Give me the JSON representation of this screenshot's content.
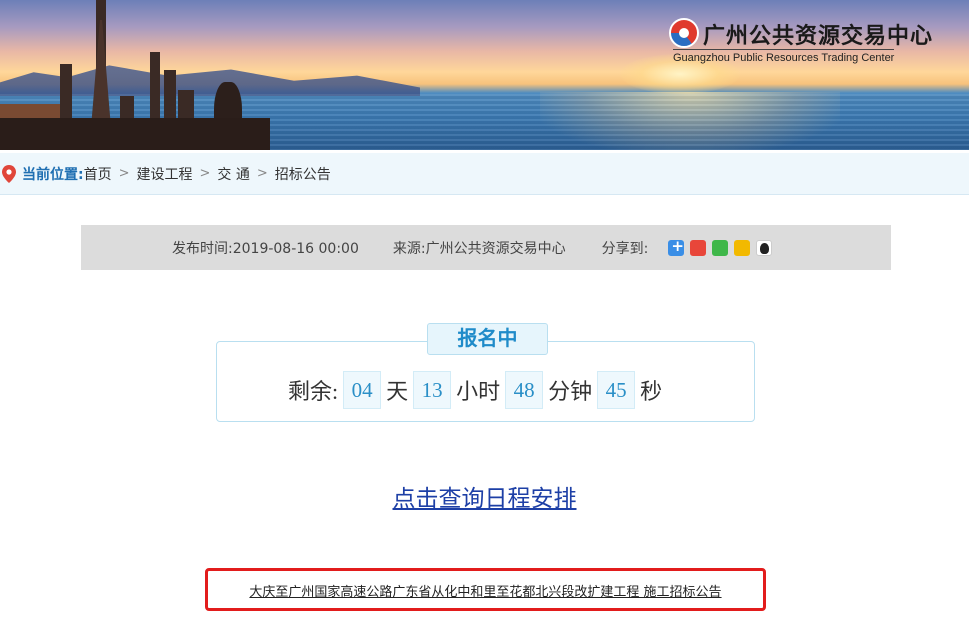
{
  "banner": {
    "logo_cn": "广州公共资源交易中心",
    "logo_en": "Guangzhou Public Resources Trading Center",
    "logo_icon": "gpr-logo-icon"
  },
  "breadcrumb": {
    "title": "当前位置:",
    "items": [
      "首页",
      "建设工程",
      "交 通",
      "招标公告"
    ],
    "separator": ">",
    "icon": "location-pin-icon"
  },
  "info": {
    "publish_time": "发布时间:2019-08-16 00:00",
    "source": "来源:广州公共资源交易中心",
    "share_label": "分享到:",
    "share_icons": [
      "plus-share-icon",
      "weibo-icon",
      "wechat-icon",
      "qzone-icon",
      "qq-icon"
    ]
  },
  "countdown": {
    "status": "报名中",
    "prefix": "剩余:",
    "days": "04",
    "days_unit": "天",
    "hours": "13",
    "hours_unit": "小时",
    "minutes": "48",
    "minutes_unit": "分钟",
    "seconds": "45",
    "seconds_unit": "秒"
  },
  "schedule_link": "点击查询日程安排",
  "tender_title": "大庆至广州国家高速公路广东省从化中和里至花都北兴段改扩建工程 施工招标公告",
  "colors": {
    "accent_blue": "#1f8bc9",
    "highlight_red": "#e21c1c",
    "link_blue": "#1d3fa6"
  }
}
